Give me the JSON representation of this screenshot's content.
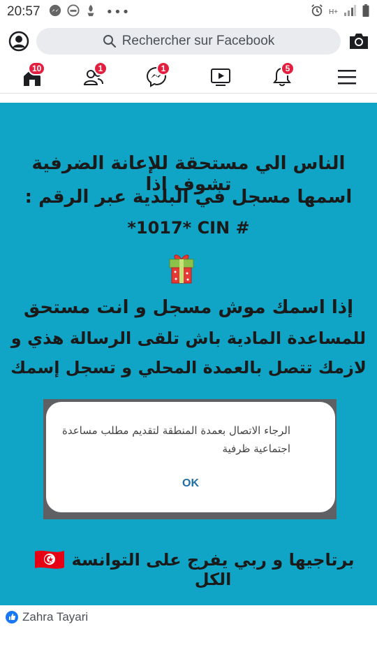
{
  "status_bar": {
    "time": "20:57",
    "network_label": "H+"
  },
  "search": {
    "placeholder": "Rechercher sur Facebook"
  },
  "nav": {
    "home_badge": "10",
    "friends_badge": "1",
    "messenger_badge": "1",
    "notifications_badge": "5"
  },
  "post": {
    "text_lines": [
      "الناس الي مستحقة للإعانة الضرفية تشوف اذا",
      "اسمها مسجل في البلدية عبر الرقم :",
      "*1017* CIN #",
      "إذا اسمك موش مسجل و انت مستحق",
      "للمساعدة المادية باش تلقى الرسالة هذي و",
      "لازمك تتصل بالعمدة المحلي و تسجل إسمك"
    ],
    "dialog_message": "الرجاء الاتصال بعمدة المنطقة لتقديم مطلب مساعدة اجتماعية ظرفية",
    "dialog_ok": "OK",
    "footer_text": "برتاجيها و ربي يفرج على التوانسة الكل"
  },
  "reactions": {
    "name": "Zahra Tayari"
  }
}
